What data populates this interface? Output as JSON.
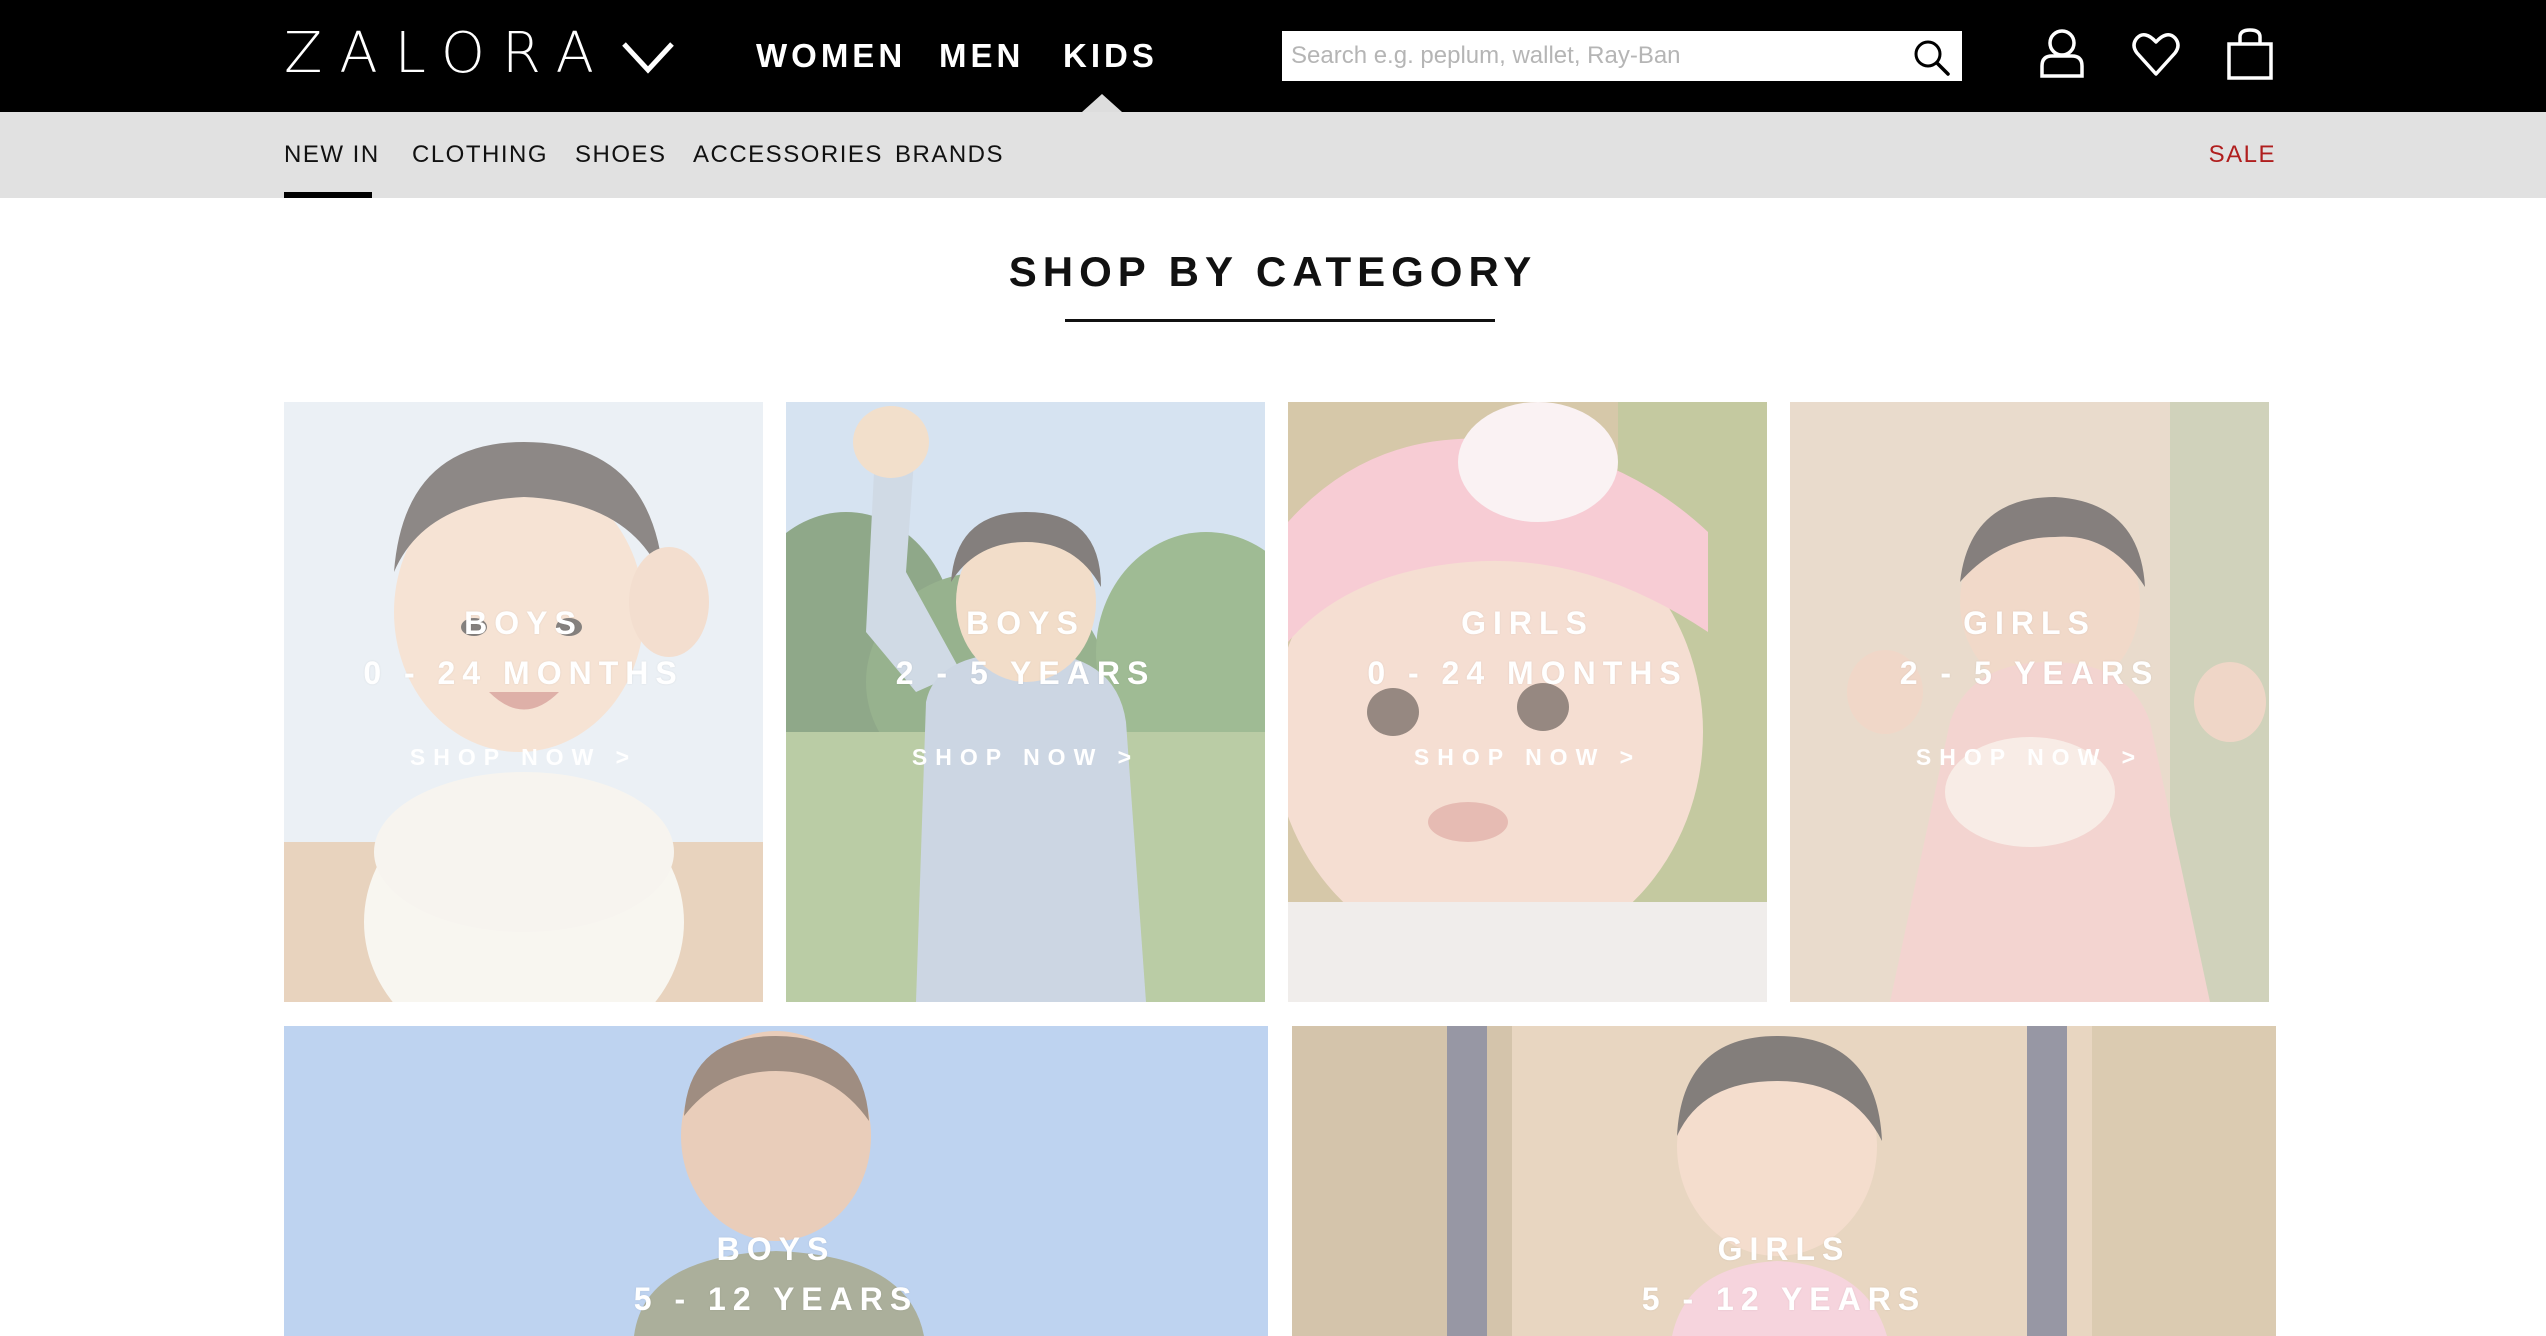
{
  "header": {
    "logo": "ZALORA",
    "nav": [
      "WOMEN",
      "MEN",
      "KIDS"
    ],
    "active_nav": "KIDS",
    "search_placeholder": "Search e.g. peplum, wallet, Ray-Ban",
    "icons": [
      "chevron-down-icon",
      "search-icon",
      "account-icon",
      "wishlist-heart-icon",
      "shopping-bag-icon"
    ]
  },
  "subnav": {
    "items": [
      "NEW IN",
      "CLOTHING",
      "SHOES",
      "ACCESSORIES",
      "BRANDS"
    ],
    "active": "NEW IN",
    "sale": "SALE",
    "sale_color": "#b01e1e"
  },
  "section": {
    "title": "SHOP BY CATEGORY"
  },
  "tiles": [
    {
      "line1": "BOYS",
      "line2": "0 - 24 MONTHS",
      "cta": "SHOP NOW >"
    },
    {
      "line1": "BOYS",
      "line2": "2 - 5 YEARS",
      "cta": "SHOP NOW >"
    },
    {
      "line1": "GIRLS",
      "line2": "0 - 24 MONTHS",
      "cta": "SHOP NOW >"
    },
    {
      "line1": "GIRLS",
      "line2": "2 - 5 YEARS",
      "cta": "SHOP NOW >"
    },
    {
      "line1": "BOYS",
      "line2": "5 - 12 YEARS"
    },
    {
      "line1": "GIRLS",
      "line2": "5 - 12 YEARS"
    }
  ]
}
